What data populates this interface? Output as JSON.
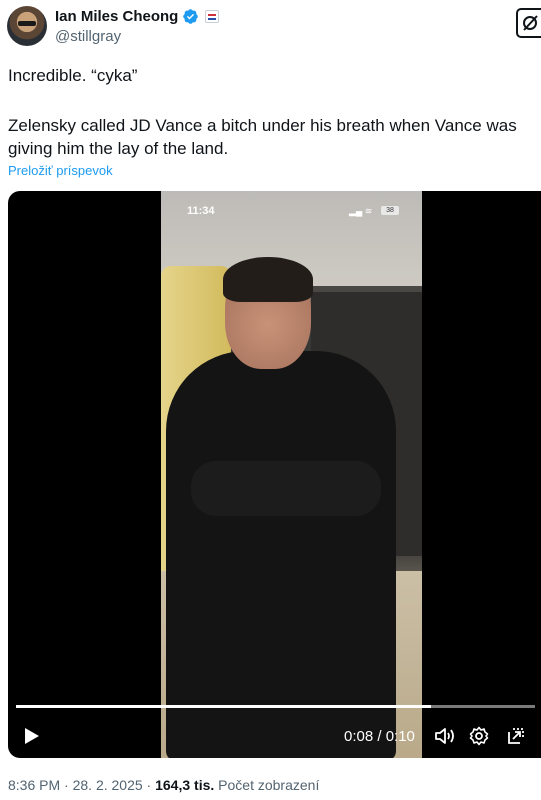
{
  "author": {
    "display_name": "Ian Miles Cheong",
    "handle": "@stillgray"
  },
  "tweet": {
    "line1": "Incredible. “cyka”",
    "line2": "Zelensky called JD Vance a bitch under his breath when Vance was giving him the lay of the land.",
    "translate_label": "Preložiť príspevok"
  },
  "video": {
    "phone_time": "11:34",
    "phone_battery": "38",
    "time_readout": "0:08 / 0:10",
    "progress_fraction": 0.8
  },
  "meta": {
    "time": "8:36 PM",
    "date": "28. 2. 2025",
    "views": "164,3 tis.",
    "views_label": "Počet zobrazení"
  },
  "colors": {
    "link": "#1d9bf0",
    "verified": "#1d9bf0",
    "secondary_text": "#536471"
  }
}
